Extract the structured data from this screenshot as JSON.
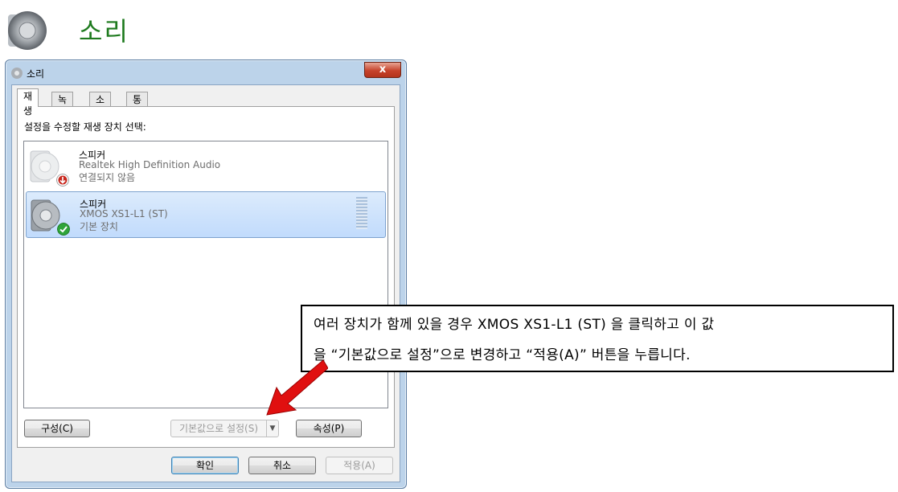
{
  "header": {
    "title": "소리"
  },
  "window": {
    "title": "소리",
    "close_label": "x",
    "tabs": [
      {
        "label": "재생",
        "active": true
      },
      {
        "label": "녹음",
        "active": false
      },
      {
        "label": "소리",
        "active": false
      },
      {
        "label": "통신",
        "active": false
      }
    ],
    "prompt": "설정을 수정할 재생 장치 선택:",
    "devices": [
      {
        "name": "스피커",
        "driver": "Realtek High Definition Audio",
        "status": "연결되지 않음",
        "badge": "red-down-arrow-icon",
        "selected": false
      },
      {
        "name": "스피커",
        "driver": "XMOS XS1-L1 (ST)",
        "status": "기본 장치",
        "badge": "green-check-icon",
        "selected": true
      }
    ],
    "buttons": {
      "configure": "구성(C)",
      "set_default": "기본값으로 설정(S)",
      "properties": "속성(P)",
      "ok": "확인",
      "cancel": "취소",
      "apply": "적용(A)"
    }
  },
  "annotation": {
    "line1": "여러 장치가 함께 있을 경우 XMOS XS1-L1 (ST) 을 클릭하고 이 값",
    "line2": "을 “기본값으로 설정”으로 변경하고 “적용(A)” 버튼을 누릅니다.",
    "arrow_color": "#e01010"
  },
  "colors": {
    "accent_green": "#1e7a1e",
    "selection": "#c1dbfc",
    "close_red": "#c6422b"
  }
}
